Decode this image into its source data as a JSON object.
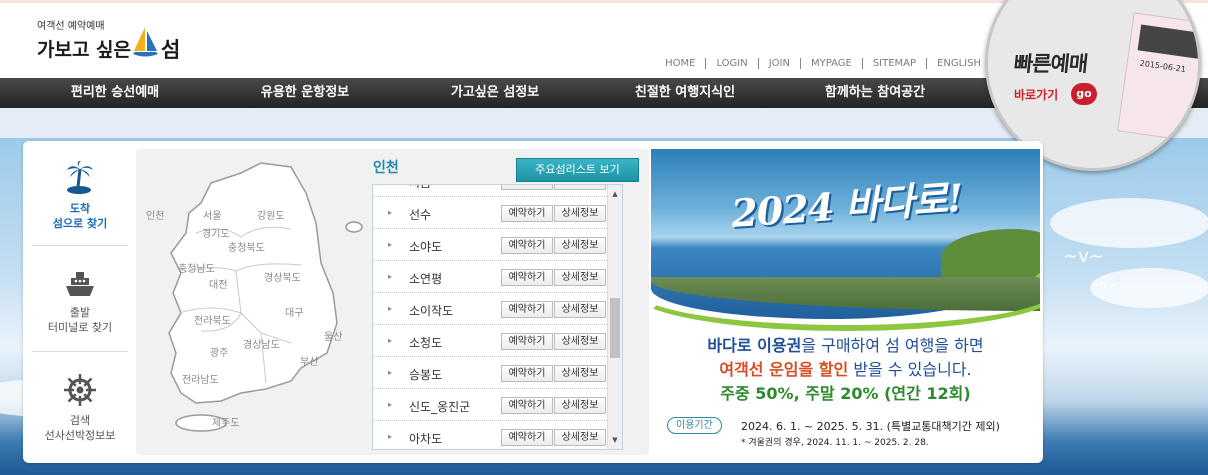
{
  "header": {
    "logo_sub": "여객선 예약예매",
    "logo_main": "가보고 싶은",
    "logo_isle": "섬"
  },
  "topmenu": [
    "HOME",
    "LOGIN",
    "JOIN",
    "MYPAGE",
    "SITEMAP",
    "ENGLISH"
  ],
  "gnb": [
    "편리한 승선예매",
    "유용한 운항정보",
    "가고싶은 섬정보",
    "친절한 여행지식인",
    "함께하는 참여공간"
  ],
  "quick": {
    "title": "빠른예매",
    "link": "바로가기",
    "go": "go",
    "ticket_date": "2015-06-21"
  },
  "left_nav": [
    {
      "label1": "도착",
      "label2": "섬으로 찾기",
      "icon": "palm-island-icon",
      "active": true
    },
    {
      "label1": "출발",
      "label2": "터미널로 찾기",
      "icon": "ship-icon",
      "active": false
    },
    {
      "label1": "검색",
      "label2": "선사선박정보보",
      "icon": "ship-wheel-icon",
      "active": false
    }
  ],
  "map": {
    "regions": [
      "인천",
      "서울",
      "강원도",
      "경기도",
      "충청북도",
      "충청남도",
      "대전",
      "경상북도",
      "대구",
      "전라북도",
      "울산",
      "경상남도",
      "광주",
      "부산",
      "전라남도",
      "제주도"
    ],
    "selected_title": "인천",
    "list_button": "주요섬리스트 보기"
  },
  "island_list": {
    "reserve_label": "예약하기",
    "detail_label": "상세정보",
    "items": [
      "시금",
      "선수",
      "소야도",
      "소연평",
      "소이작도",
      "소청도",
      "승봉도",
      "신도_옹진군",
      "아차도"
    ]
  },
  "banner": {
    "headline": "2024 바다로!",
    "line1_a": "바다로 이용권",
    "line1_b": "을 구매하여 섬 여행을 하면",
    "line2_a": "여객선 운임을 할인",
    "line2_b": " 받을 수 있습니다.",
    "line3": "주중 50%, 주말 20% (연간 12회)",
    "period_label": "이용기간",
    "period": "2024. 6. 1. ~ 2025. 5. 31. (특별교통대책기간 제외)",
    "note": "* 겨울권의 경우, 2024. 11. 1. ~ 2025. 2. 28."
  }
}
